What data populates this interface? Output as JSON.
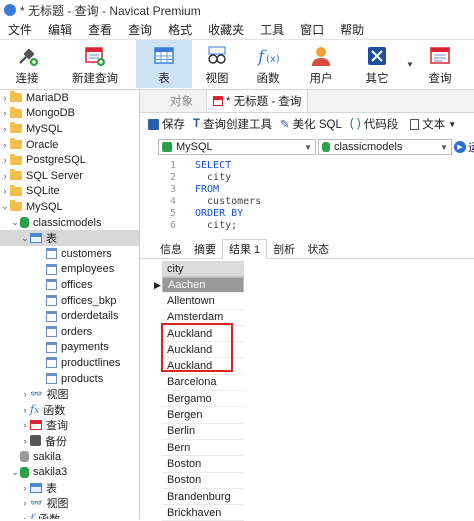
{
  "window": {
    "title": "* 无标题 - 查询 - Navicat Premium"
  },
  "menu": [
    "文件",
    "编辑",
    "查看",
    "查询",
    "格式",
    "收藏夹",
    "工具",
    "窗口",
    "帮助"
  ],
  "toolbar": {
    "connect": "连接",
    "new_query": "新建查询",
    "table": "表",
    "view": "视图",
    "function": "函数",
    "user": "用户",
    "other": "其它",
    "query": "查询"
  },
  "sidebar": {
    "connections": [
      "MariaDB",
      "MongoDB",
      "MySQL",
      "Oracle",
      "PostgreSQL",
      "SQL Server",
      "SQLite",
      "MySQL"
    ],
    "db_classic": "classicmodels",
    "tables_node": "表",
    "tables": [
      "customers",
      "employees",
      "offices",
      "offices_bkp",
      "orderdetails",
      "orders",
      "payments",
      "productlines",
      "products"
    ],
    "views": "视图",
    "functions": "函数",
    "queries": "查询",
    "backups": "备份",
    "db_sakila": "sakila",
    "db_sakila3": "sakila3",
    "s3_tables": "表",
    "s3_views": "视图",
    "s3_functions": "函数"
  },
  "tabs": {
    "objects": "对象",
    "query_tab": "* 无标题 - 查询"
  },
  "query_toolbar": {
    "save": "保存",
    "builder": "查询创建工具",
    "beautify": "美化 SQL",
    "snippet": "代码段",
    "text": "文本",
    "run": "运"
  },
  "connection_select": "MySQL",
  "database_select": "classicmodels",
  "editor_lines": [
    {
      "n": "1",
      "kw": "SELECT",
      "txt": ""
    },
    {
      "n": "2",
      "kw": "",
      "txt": "  city"
    },
    {
      "n": "3",
      "kw": "FROM",
      "txt": ""
    },
    {
      "n": "4",
      "kw": "",
      "txt": "  customers"
    },
    {
      "n": "5",
      "kw": "ORDER BY",
      "txt": ""
    },
    {
      "n": "6",
      "kw": "",
      "txt": "  city;"
    }
  ],
  "result_tabs": [
    "信息",
    "摘要",
    "结果 1",
    "剖析",
    "状态"
  ],
  "result": {
    "column": "city",
    "rows": [
      "Aachen",
      "Allentown",
      "Amsterdam",
      "Auckland",
      "Auckland",
      "Auckland",
      "Barcelona",
      "Bergamo",
      "Bergen",
      "Berlin",
      "Bern",
      "Boston",
      "Boston",
      "Brandenburg",
      "Brickhaven"
    ]
  },
  "colors": {
    "keyword": "#1a4fd1",
    "highlight": "#dd2222",
    "active_toolbar": "#cfe3f7"
  }
}
